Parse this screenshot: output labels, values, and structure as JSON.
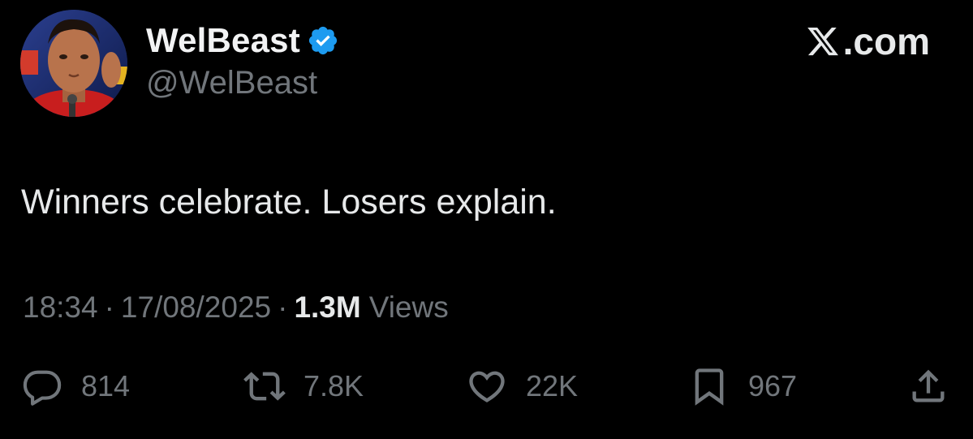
{
  "author": {
    "display_name": "WelBeast",
    "handle": "@WelBeast",
    "verified": true,
    "verified_color": "#1d9bf0"
  },
  "brand": {
    "text": ".com",
    "icon": "x-logo-icon"
  },
  "tweet": {
    "text": "Winners celebrate. Losers explain."
  },
  "meta": {
    "time": "18:34",
    "separator": "·",
    "date": "17/08/2025",
    "views_count": "1.3M",
    "views_label": "Views"
  },
  "actions": {
    "replies": {
      "icon": "reply-icon",
      "count": "814"
    },
    "reposts": {
      "icon": "repost-icon",
      "count": "7.8K"
    },
    "likes": {
      "icon": "heart-icon",
      "count": "22K"
    },
    "bookmarks": {
      "icon": "bookmark-icon",
      "count": "967"
    },
    "share": {
      "icon": "share-icon"
    }
  },
  "colors": {
    "background": "#000000",
    "primary_text": "#e7e9ea",
    "secondary_text": "#71767b"
  }
}
